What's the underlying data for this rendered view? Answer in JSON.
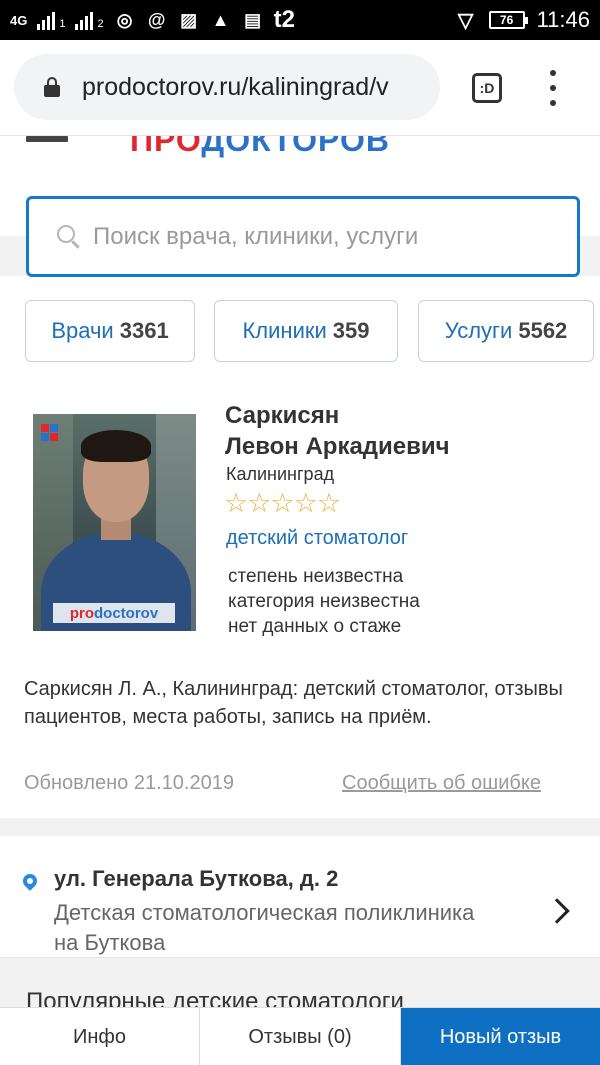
{
  "status_bar": {
    "network": "4G",
    "sim1": "1",
    "sim2": "2",
    "carrier": "t2",
    "battery": "76",
    "time": "11:46"
  },
  "browser": {
    "url": "prodoctorov.ru/kaliningrad/v",
    "tab_switcher": ":D"
  },
  "search": {
    "placeholder": "Поиск врача, клиники, услуги"
  },
  "categories": [
    {
      "label": "Врачи",
      "count": "3361"
    },
    {
      "label": "Клиники",
      "count": "359"
    },
    {
      "label": "Услуги",
      "count": "5562"
    }
  ],
  "doctor": {
    "surname": "Саркисян",
    "given_names": "Левон Аркадиевич",
    "city": "Калининград",
    "rating_stars": "☆☆☆☆☆",
    "specialty": "детский стоматолог",
    "degree": "степень неизвестна",
    "category": "категория неизвестна",
    "experience": "нет данных о стаже",
    "photo_watermark_a": "pro",
    "photo_watermark_b": "doctorov"
  },
  "description": "Саркисян Л. А., Калининград: детский стоматолог, отзывы пациентов, места работы, запись на приём.",
  "updated": "Обновлено 21.10.2019",
  "report_error": "Сообщить об ошибке",
  "address": {
    "street": "ул. Генерала Буткова, д. 2",
    "clinic": "Детская стоматологическая поликлиника на Буткова"
  },
  "popular_heading": "Популярные детские стоматологи",
  "bottom_tabs": {
    "info": "Инфо",
    "reviews": "Отзывы (0)",
    "new_review": "Новый отзыв"
  },
  "colors": {
    "accent": "#1779c9",
    "link": "#1d6fb8",
    "primary_button": "#0f6fc2",
    "star": "#e9b33a"
  }
}
